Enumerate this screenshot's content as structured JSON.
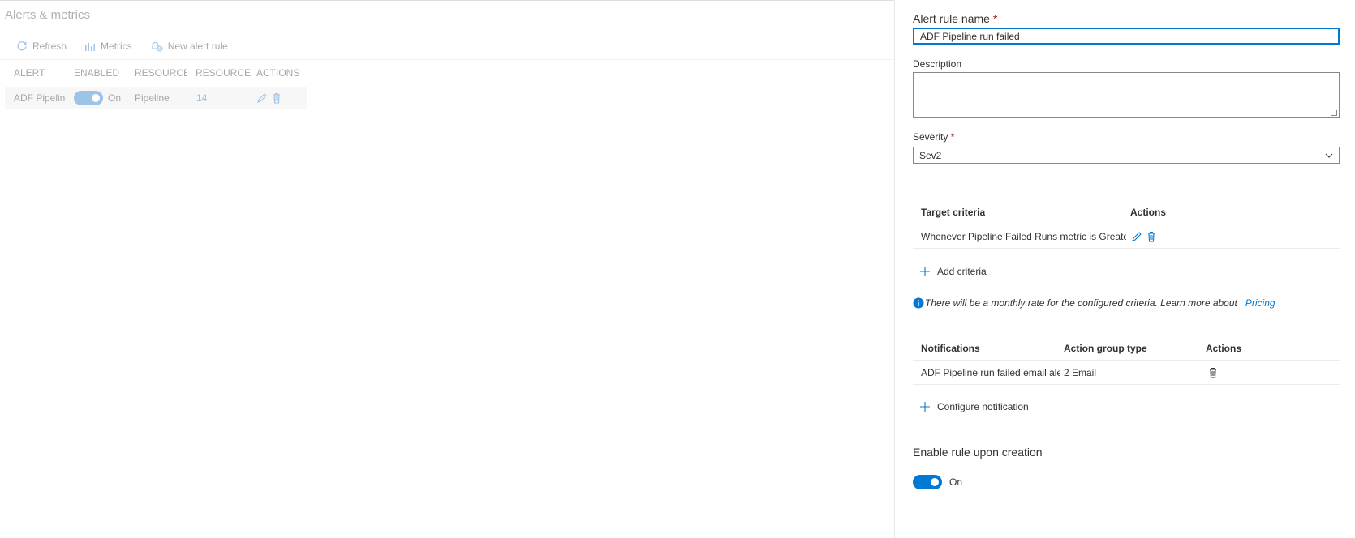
{
  "left": {
    "title": "Alerts & metrics",
    "toolbar": {
      "refresh": "Refresh",
      "metrics": "Metrics",
      "new_alert_rule": "New alert rule"
    },
    "table": {
      "columns": [
        "ALERT",
        "ENABLED",
        "RESOURCE T",
        "RESOURCES",
        "ACTIONS"
      ],
      "rows": [
        {
          "alert": "ADF Pipeline",
          "enabled": "On",
          "resource_type": "Pipeline",
          "resources": "14"
        }
      ]
    }
  },
  "panel": {
    "rule_name_label": "Alert rule name",
    "required_mark": "*",
    "rule_name_value": "ADF Pipeline run failed",
    "description_label": "Description",
    "description_value": "",
    "severity_label": "Severity",
    "severity_value": "Sev2",
    "criteria_table": {
      "headers": [
        "Target criteria",
        "Actions"
      ],
      "rows": [
        {
          "criteria": "Whenever Pipeline Failed Runs metric is Greater T"
        }
      ]
    },
    "add_criteria": "Add criteria",
    "info_text": "There will be a monthly rate for the configured criteria. Learn more about",
    "info_link": "Pricing",
    "notifications_table": {
      "headers": [
        "Notifications",
        "Action group type",
        "Actions"
      ],
      "rows": [
        {
          "name": "ADF Pipeline run failed email ale",
          "type": "2 Email"
        }
      ]
    },
    "configure_notification": "Configure notification",
    "enable_label": "Enable rule upon creation",
    "enable_state": "On"
  },
  "colors": {
    "accent": "#0078d4",
    "required": "#a4262c",
    "dimmed_text": "#a6a6a6"
  }
}
